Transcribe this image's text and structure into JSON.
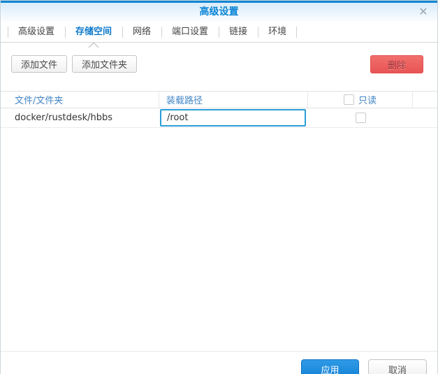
{
  "window": {
    "title": "高级设置",
    "close_icon": "✕"
  },
  "tabs": [
    {
      "label": "高级设置",
      "active": false
    },
    {
      "label": "存储空间",
      "active": true
    },
    {
      "label": "网络",
      "active": false
    },
    {
      "label": "端口设置",
      "active": false
    },
    {
      "label": "链接",
      "active": false
    },
    {
      "label": "环境",
      "active": false
    }
  ],
  "toolbar": {
    "add_file_label": "添加文件",
    "add_folder_label": "添加文件夹",
    "delete_label": "删除"
  },
  "table": {
    "headers": {
      "file_folder": "文件/文件夹",
      "mount_path": "装载路径",
      "read_only": "只读"
    },
    "rows": [
      {
        "file_folder": "docker/rustdesk/hbbs",
        "mount_path_value": "/root",
        "read_only_checked": false
      }
    ]
  },
  "footer": {
    "apply_label": "应用",
    "cancel_label": "取消"
  },
  "colors": {
    "titlebar_accent": "#0f86d3",
    "title_text": "#0b85d6",
    "active_tab_text": "#0c79cb",
    "table_header_text": "#4285c6",
    "input_focus_border": "#2b9ed8",
    "delete_button_bg": "#e85454",
    "apply_button_bg": "#1580d6"
  }
}
